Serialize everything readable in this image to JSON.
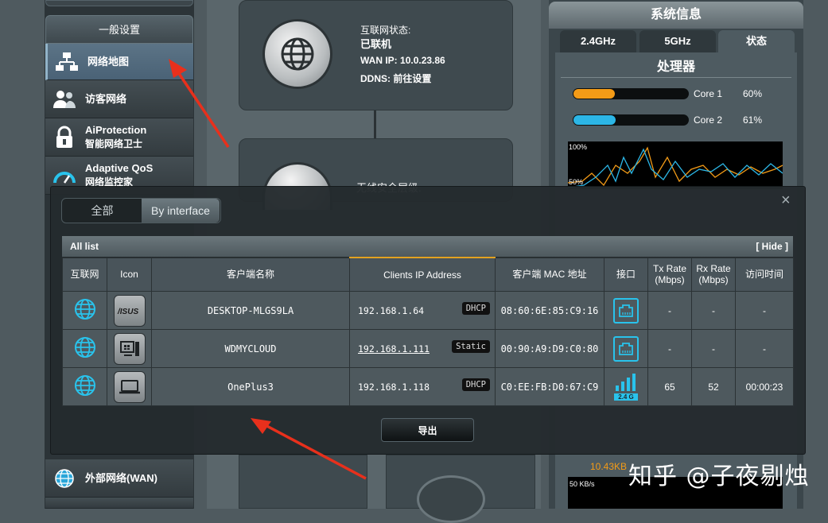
{
  "sidebar": {
    "section_title": "一般设置",
    "items": [
      {
        "label": "网络地图",
        "icon": "network-map-icon"
      },
      {
        "label": "访客网络",
        "icon": "guest-network-icon"
      },
      {
        "label": "AiProtection",
        "sublabel": "智能网络卫士",
        "icon": "lock-icon"
      },
      {
        "label": "Adaptive QoS",
        "sublabel": "网络监控家",
        "icon": "speedometer-icon"
      }
    ],
    "wan_item": {
      "label": "外部网络(WAN)",
      "icon": "globe-icon"
    }
  },
  "internet": {
    "status_label": "互联网状态:",
    "status_value": "已联机",
    "wan_ip_label": "WAN IP:",
    "wan_ip_value": "10.0.23.86",
    "ddns_label": "DDNS:",
    "ddns_value": "前往设置"
  },
  "security": {
    "label_partial": "无线安全层级:"
  },
  "system_info": {
    "title": "系统信息",
    "tabs": [
      "2.4GHz",
      "5GHz",
      "状态"
    ],
    "active_tab": "状态",
    "cpu_title": "处理器",
    "cores": [
      {
        "name": "Core 1",
        "percent": 60,
        "display": "60%",
        "color": "#f39b17"
      },
      {
        "name": "Core 2",
        "percent": 61,
        "display": "61%",
        "color": "#2cb6e6"
      }
    ],
    "chart_labels": [
      "100%",
      "50%"
    ],
    "download_value": "10.43KB",
    "scale_label": "50 KB/s"
  },
  "modal": {
    "close_glyph": "×",
    "seg_all": "全部",
    "seg_interface": "By interface",
    "list_title": "All list",
    "hide_label": "[ Hide ]",
    "columns": [
      "互联网",
      "Icon",
      "客户端名称",
      "Clients IP Address",
      "客户端 MAC 地址",
      "接口",
      "Tx Rate (Mbps)",
      "Rx Rate (Mbps)",
      "访问时间"
    ],
    "rows": [
      {
        "name": "DESKTOP-MLGS9LA",
        "ip": "192.168.1.64",
        "ip_type": "DHCP",
        "mac": "08:60:6E:85:C9:16",
        "iface": "wired",
        "tx": "-",
        "rx": "-",
        "time": "-",
        "device_icon": "asus-logo-icon"
      },
      {
        "name": "WDMYCLOUD",
        "ip": "192.168.1.111",
        "ip_type": "Static",
        "mac": "00:90:A9:D9:C0:80",
        "iface": "wired",
        "tx": "-",
        "rx": "-",
        "time": "-",
        "device_icon": "windows-device-icon"
      },
      {
        "name": "OnePlus3",
        "ip": "192.168.1.118",
        "ip_type": "DHCP",
        "mac": "C0:EE:FB:D0:67:C9",
        "iface": "wifi",
        "iface_band": "2.4 G",
        "tx": "65",
        "rx": "52",
        "time": "00:00:23",
        "device_icon": "laptop-icon"
      }
    ],
    "export_label": "导出"
  },
  "watermark": "知乎 @子夜剔烛",
  "colors": {
    "accent_blue": "#29c3ec",
    "annotation_red": "#e8301c"
  }
}
